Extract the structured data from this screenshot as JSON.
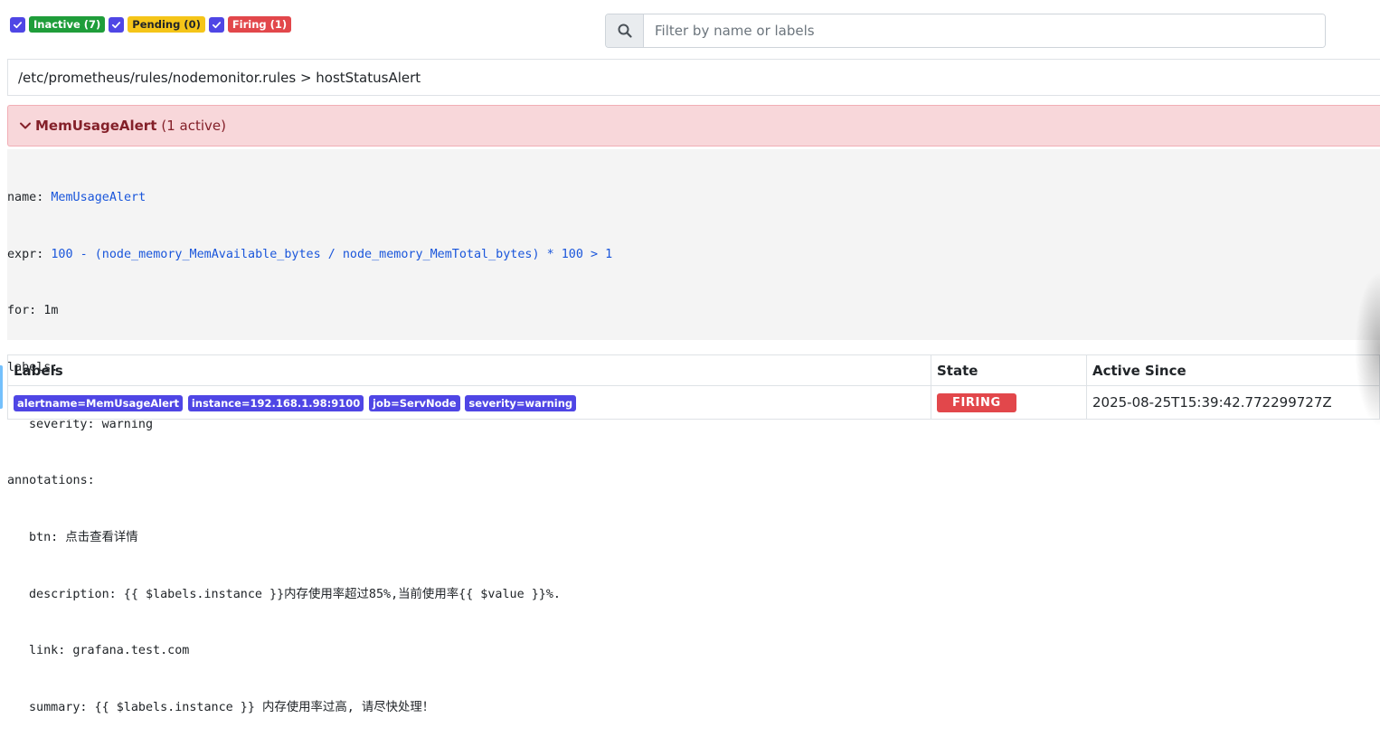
{
  "filters": {
    "inactive_label": "Inactive (7)",
    "pending_label": "Pending (0)",
    "firing_label": "Firing (1)"
  },
  "search": {
    "placeholder": "Filter by name or labels"
  },
  "group": {
    "path": "/etc/prometheus/rules/nodemonitor.rules > hostStatusAlert"
  },
  "alert": {
    "name": "MemUsageAlert",
    "active_count": "(1 active)"
  },
  "rule": {
    "name_key": "name:",
    "name_value": "MemUsageAlert",
    "expr_key": "expr:",
    "expr_value": "100 - (node_memory_MemAvailable_bytes / node_memory_MemTotal_bytes) * 100 > 1",
    "for_line": "for: 1m",
    "labels_key": "labels:",
    "severity_line": "severity: warning",
    "annotations_key": "annotations:",
    "btn_line": "btn: 点击查看详情",
    "description_line": "description: {{ $labels.instance }}内存使用率超过85%,当前使用率{{ $value }}%.",
    "link_line": "link: grafana.test.com",
    "summary_line": "summary: {{ $labels.instance }} 内存使用率过高, 请尽快处理！"
  },
  "table": {
    "headers": [
      "Labels",
      "State",
      "Active Since"
    ],
    "rows": [
      {
        "labels": [
          "alertname=MemUsageAlert",
          "instance=192.168.1.98:9100",
          "job=ServNode",
          "severity=warning"
        ],
        "state": "FIRING",
        "active_since": "2025-08-25T15:39:42.772299727Z"
      }
    ]
  },
  "colors": {
    "checkbox": "#4f46e5",
    "inactive": "#1f9d3a",
    "pending": "#f5c518",
    "firing": "#e2474b",
    "alert_bg": "#f8d7da",
    "alert_text": "#842029",
    "expr_blue": "#1a56db",
    "label_badge": "#4f46e5"
  },
  "icons": {
    "checkbox": "check-icon",
    "search": "search-icon",
    "collapse": "chevron-down-icon"
  }
}
